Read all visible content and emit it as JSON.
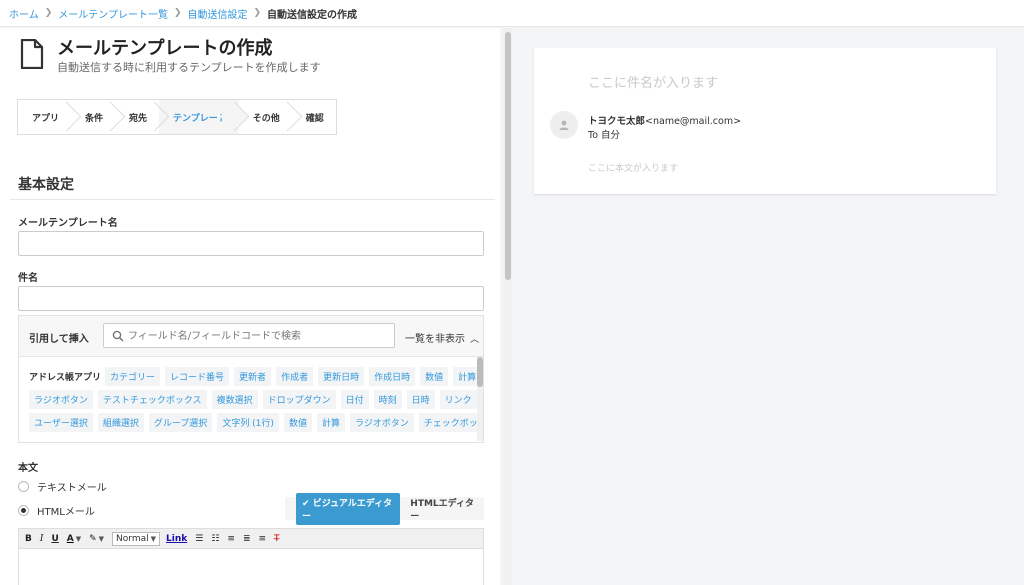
{
  "breadcrumb": {
    "items": [
      "ホーム",
      "メールテンプレート一覧",
      "自動送信設定"
    ],
    "current": "自動送信設定の作成"
  },
  "header": {
    "title": "メールテンプレートの作成",
    "subtitle": "自動送信する時に利用するテンプレートを作成します"
  },
  "steps": [
    "アプリ",
    "条件",
    "宛先",
    "テンプレート",
    "その他",
    "確認"
  ],
  "active_step": "テンプレート",
  "basic": {
    "section_title": "基本設定",
    "template_name_label": "メールテンプレート名",
    "template_name_value": "",
    "subject_label": "件名",
    "subject_value": ""
  },
  "insert": {
    "label": "引用して挿入",
    "search_placeholder": "フィールド名/フィールドコードで検索",
    "toggle_label": "一覧を非表示",
    "group_label": "アドレス帳アプリ",
    "row1": [
      "カテゴリー",
      "レコード番号",
      "更新者",
      "作成者",
      "更新日時",
      "作成日時",
      "数値",
      "計算"
    ],
    "row2": [
      "ラジオボタン",
      "テストチェックボックス",
      "複数選択",
      "ドロップダウン",
      "日付",
      "時刻",
      "日時",
      "リンク"
    ],
    "row3": [
      "ユーザー選択",
      "組織選択",
      "グループ選択",
      "文字列 (1行)",
      "数値",
      "計算",
      "ラジオボタン",
      "チェックボックス"
    ]
  },
  "body": {
    "label": "本文",
    "option_text": "テキストメール",
    "option_html": "HTMLメール",
    "selected": "HTMLメール",
    "tab_visual": "ビジュアルエディター",
    "tab_html": "HTMLエディター",
    "active_tab": "ビジュアルエディター"
  },
  "toolbar": {
    "bold": "B",
    "italic": "I",
    "underline": "U",
    "font_color": "A",
    "format_select": "Normal",
    "link": "Link"
  },
  "preview": {
    "subject_placeholder": "ここに件名が入ります",
    "from_name": "トヨクモ太郎",
    "from_email": "<name@mail.com>",
    "to": "To 自分",
    "body_placeholder": "ここに本文が入ります"
  },
  "colors": {
    "accent": "#3498db",
    "tab_active_bg": "#3b9bd1",
    "link": "#1a0dab"
  }
}
